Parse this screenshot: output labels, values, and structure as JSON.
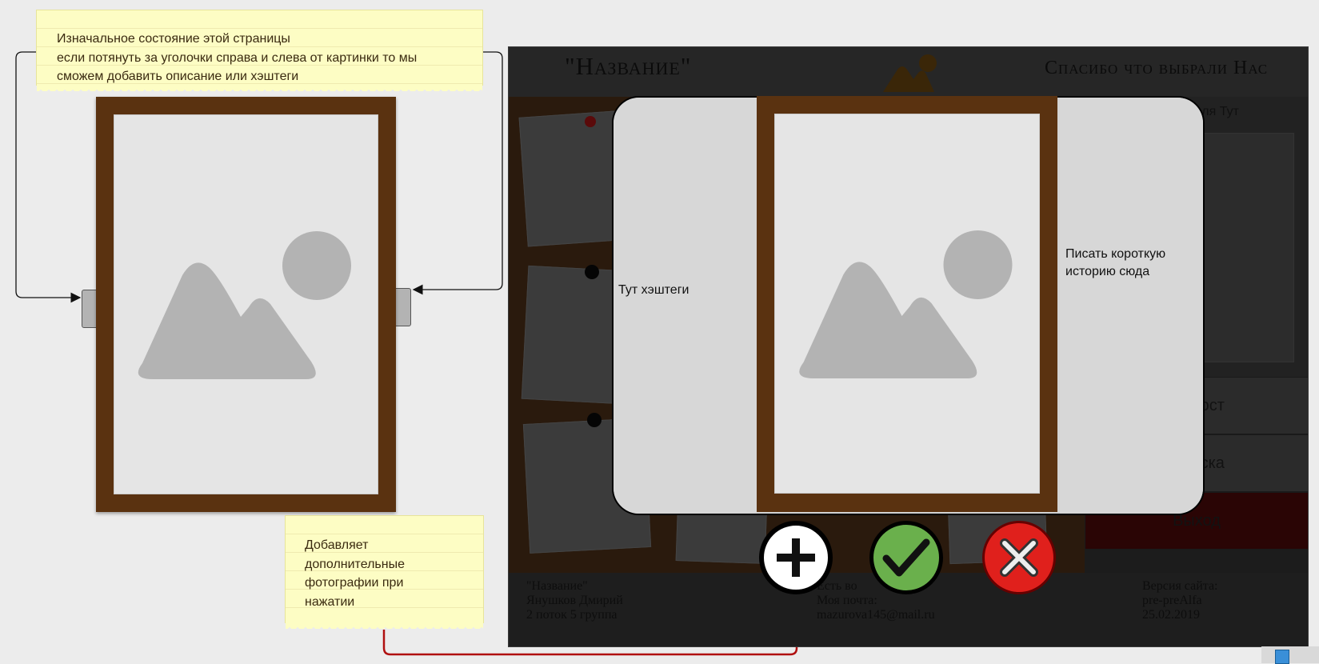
{
  "notes": {
    "top": [
      "Изначальное состояние этой страницы",
      "если потянуть за уголочки справа и слева от картинки то мы",
      "сможем добавить описание или хэштеги"
    ],
    "bottom": [
      "Добавляет",
      "дополнительные",
      "фотографии при",
      "нажатии"
    ]
  },
  "site": {
    "title": "\"Название\"",
    "thanks": "Спасибо что выбрали Нас",
    "user_label": "ователя Тут",
    "menu": [
      "ть Пост",
      "й доска",
      "Выход"
    ],
    "footer": {
      "col1": [
        "\"Название\"",
        "Янушков Дмирий",
        "2 поток 5 группа"
      ],
      "col2": [
        "Есть во",
        "Моя почта:",
        "mazurova145@mail.ru"
      ],
      "col3": [
        "Версия сайта:",
        "pre-preAlfa",
        "25.02.2019"
      ]
    }
  },
  "modal": {
    "hashtags_label": "Тут хэштеги",
    "story_label": [
      "Писать короткую",
      "историю сюда"
    ]
  },
  "actions": {
    "add": "plus-icon",
    "confirm": "check-icon",
    "cancel": "close-icon"
  },
  "colors": {
    "frame": "#5a3210",
    "note": "#fdfdc4",
    "confirm": "#6ab04c",
    "cancel": "#e0201c",
    "arrow": "#b01010"
  }
}
